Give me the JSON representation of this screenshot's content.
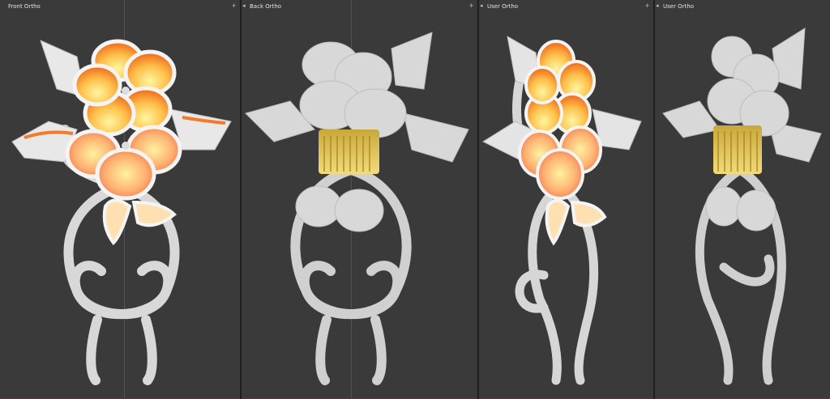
{
  "viewports": [
    {
      "label": "Front Ortho"
    },
    {
      "label": "Back Ortho"
    },
    {
      "label": "User Ortho"
    },
    {
      "label": "User Ortho"
    }
  ],
  "colors": {
    "background": "#3a3a3a",
    "petal_outer": "#f47a2a",
    "petal_inner": "#fff08a",
    "stem": "#dcdcdc",
    "comb": "#d8b64a",
    "z_axis": "#3f51b5"
  }
}
